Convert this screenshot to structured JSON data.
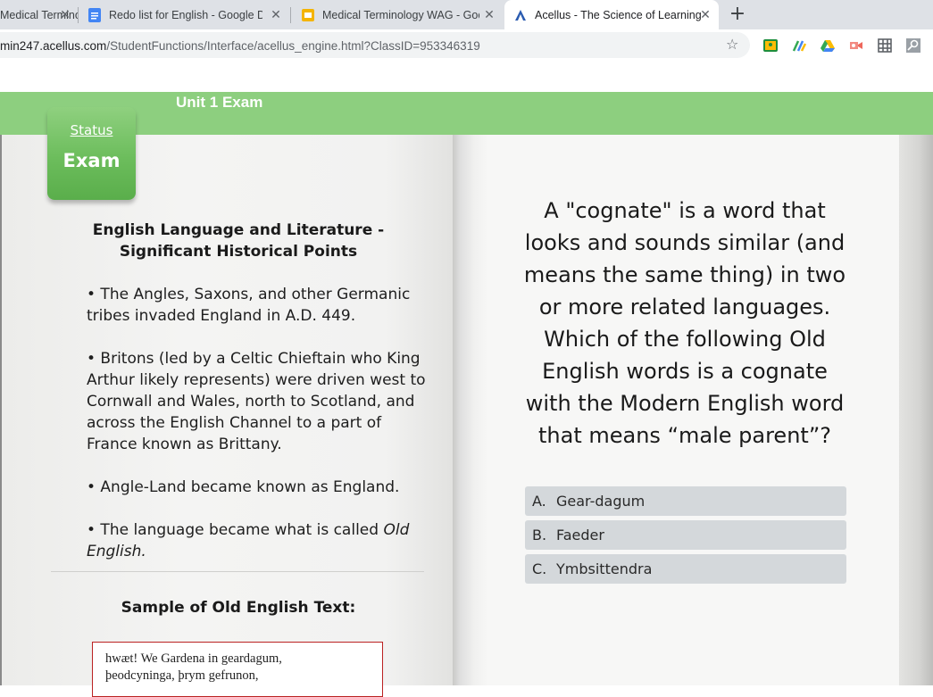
{
  "browser": {
    "tabs": [
      {
        "title": "Medical Terminology",
        "icon": "slides-icon",
        "active": false
      },
      {
        "title": "Redo list for English - Google Docs",
        "icon": "docs-icon",
        "active": false
      },
      {
        "title": "Medical Terminology WAG - Google Slides",
        "icon": "slides-icon",
        "active": false
      },
      {
        "title": "Acellus - The Science of Learning",
        "icon": "acellus-icon",
        "active": true
      }
    ],
    "url_domain": "min247.acellus.com",
    "url_path": "/StudentFunctions/Interface/acellus_engine.html?ClassID=953346319",
    "colors": {
      "tabstrip": "#dee1e6",
      "header_green": "#8dcf7f"
    }
  },
  "app": {
    "unit_title": "Unit 1 Exam",
    "status_label": "Status",
    "status_value": "Exam",
    "left": {
      "heading_line1": "English Language and Literature -",
      "heading_line2": "Significant Historical Points",
      "bullets": [
        "• The Angles, Saxons, and other Germanic tribes invaded England in A.D. 449.",
        "• Britons (led by a Celtic Chieftain who King Arthur likely represents) were driven west to Cornwall and Wales, north to Scotland, and across the English Channel to a part of France known as Brittany.",
        "• Angle-Land became known as England.",
        "• The language became what is called "
      ],
      "bullet4_italic": "Old English.",
      "sample_heading": "Sample of Old English Text:",
      "manuscript_lines": [
        "hwæt! We Gardena    in geardagum,",
        "þeodcyninga,    þrym gefrunon,"
      ]
    },
    "question": "A \"cognate\" is a word that looks and sounds similar (and means the same thing) in two or more related languages. Which of the following Old English words is a cognate with the Modern English word that means “male parent”?",
    "answers": [
      {
        "letter": "A.",
        "text": "Gear-dagum"
      },
      {
        "letter": "B.",
        "text": "Faeder"
      },
      {
        "letter": "C.",
        "text": "Ymbsittendra"
      }
    ]
  }
}
